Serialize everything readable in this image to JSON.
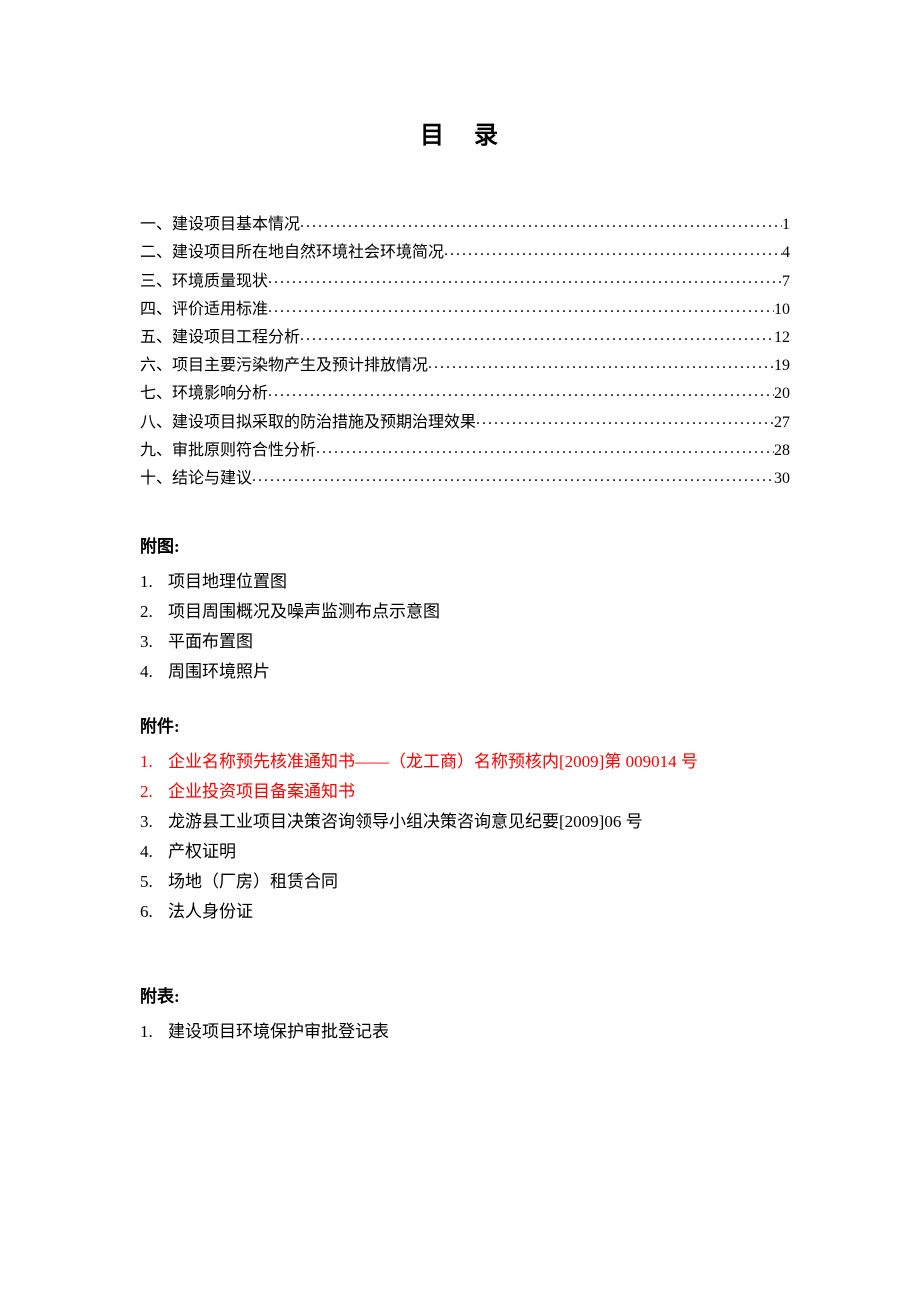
{
  "title": "目  录",
  "toc": [
    {
      "label": "一、建设项目基本情况",
      "page": "1"
    },
    {
      "label": "二、建设项目所在地自然环境社会环境简况",
      "page": "4"
    },
    {
      "label": "三、环境质量现状",
      "page": "7"
    },
    {
      "label": "四、评价适用标准",
      "page": "10"
    },
    {
      "label": "五、建设项目工程分析",
      "page": "12"
    },
    {
      "label": "六、项目主要污染物产生及预计排放情况",
      "page": "19"
    },
    {
      "label": "七、环境影响分析",
      "page": "20"
    },
    {
      "label": "八、建设项目拟采取的防治措施及预期治理效果",
      "page": "27"
    },
    {
      "label": "九、审批原则符合性分析",
      "page": "28"
    },
    {
      "label": "十、结论与建议",
      "page": "30"
    }
  ],
  "futu": {
    "heading": "附图:",
    "items": [
      {
        "num": "1.",
        "text": "项目地理位置图"
      },
      {
        "num": "2.",
        "text": "项目周围概况及噪声监测布点示意图"
      },
      {
        "num": "3.",
        "text": "平面布置图"
      },
      {
        "num": "4.",
        "text": "周围环境照片"
      }
    ]
  },
  "fujian": {
    "heading": "附件:",
    "items": [
      {
        "num": "1.",
        "text": "企业名称预先核准通知书——（龙工商）名称预核内[2009]第 009014 号",
        "red": true
      },
      {
        "num": "2.",
        "text": "企业投资项目备案通知书",
        "red": true
      },
      {
        "num": "3.",
        "text": "龙游县工业项目决策咨询领导小组决策咨询意见纪要[2009]06 号",
        "red": false
      },
      {
        "num": "4.",
        "text": "产权证明",
        "red": false
      },
      {
        "num": "5.",
        "text": "场地（厂房）租赁合同",
        "red": false
      },
      {
        "num": "6.",
        "text": "法人身份证",
        "red": false
      }
    ]
  },
  "fubiao": {
    "heading": "附表:",
    "items": [
      {
        "num": "1.",
        "text": "建设项目环境保护审批登记表"
      }
    ]
  }
}
